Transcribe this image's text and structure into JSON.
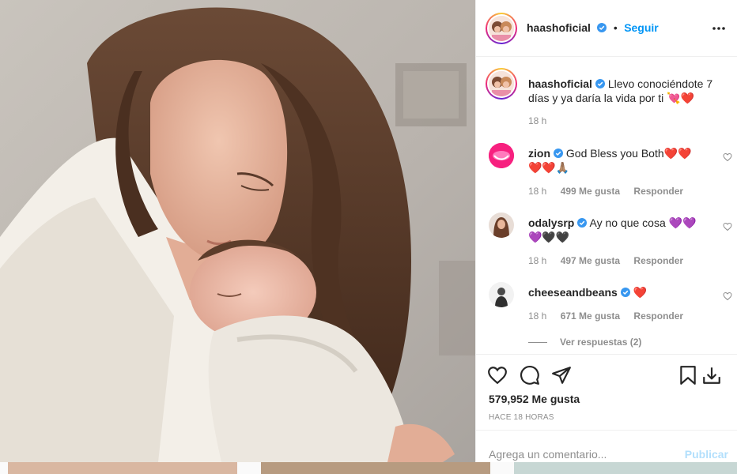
{
  "post": {
    "username": "haashoficial",
    "follow_label": "Seguir",
    "dot": "•"
  },
  "caption": {
    "username": "haashoficial",
    "text": "Llevo conociéndote 7 días y ya daría la vida por ti 💘❤️",
    "time": "18 h"
  },
  "comments": [
    {
      "username": "zion",
      "text": "God Bless you Both❤️❤️❤️❤️🙏🏽",
      "time": "18 h",
      "likes": "499 Me gusta",
      "reply": "Responder"
    },
    {
      "username": "odalysrp",
      "text": "Ay no que cosa 💜💜💜🖤🖤",
      "time": "18 h",
      "likes": "497 Me gusta",
      "reply": "Responder"
    },
    {
      "username": "cheeseandbeans",
      "text": "❤️",
      "time": "18 h",
      "likes": "671 Me gusta",
      "reply": "Responder"
    }
  ],
  "view_replies": "Ver respuestas (2)",
  "likes_count": "579,952 Me gusta",
  "posted_ago": "HACE 18 HORAS",
  "comment_input": {
    "placeholder": "Agrega un comentario...",
    "post_label": "Publicar"
  },
  "colors": {
    "accent": "#0095f6",
    "verified": "#3897f0",
    "muted": "#8e8e8e",
    "post_disabled": "#b2dffc"
  },
  "icons": [
    "more-options-icon",
    "heart-icon",
    "comment-icon",
    "share-icon",
    "save-icon",
    "download-icon",
    "verified-icon"
  ]
}
